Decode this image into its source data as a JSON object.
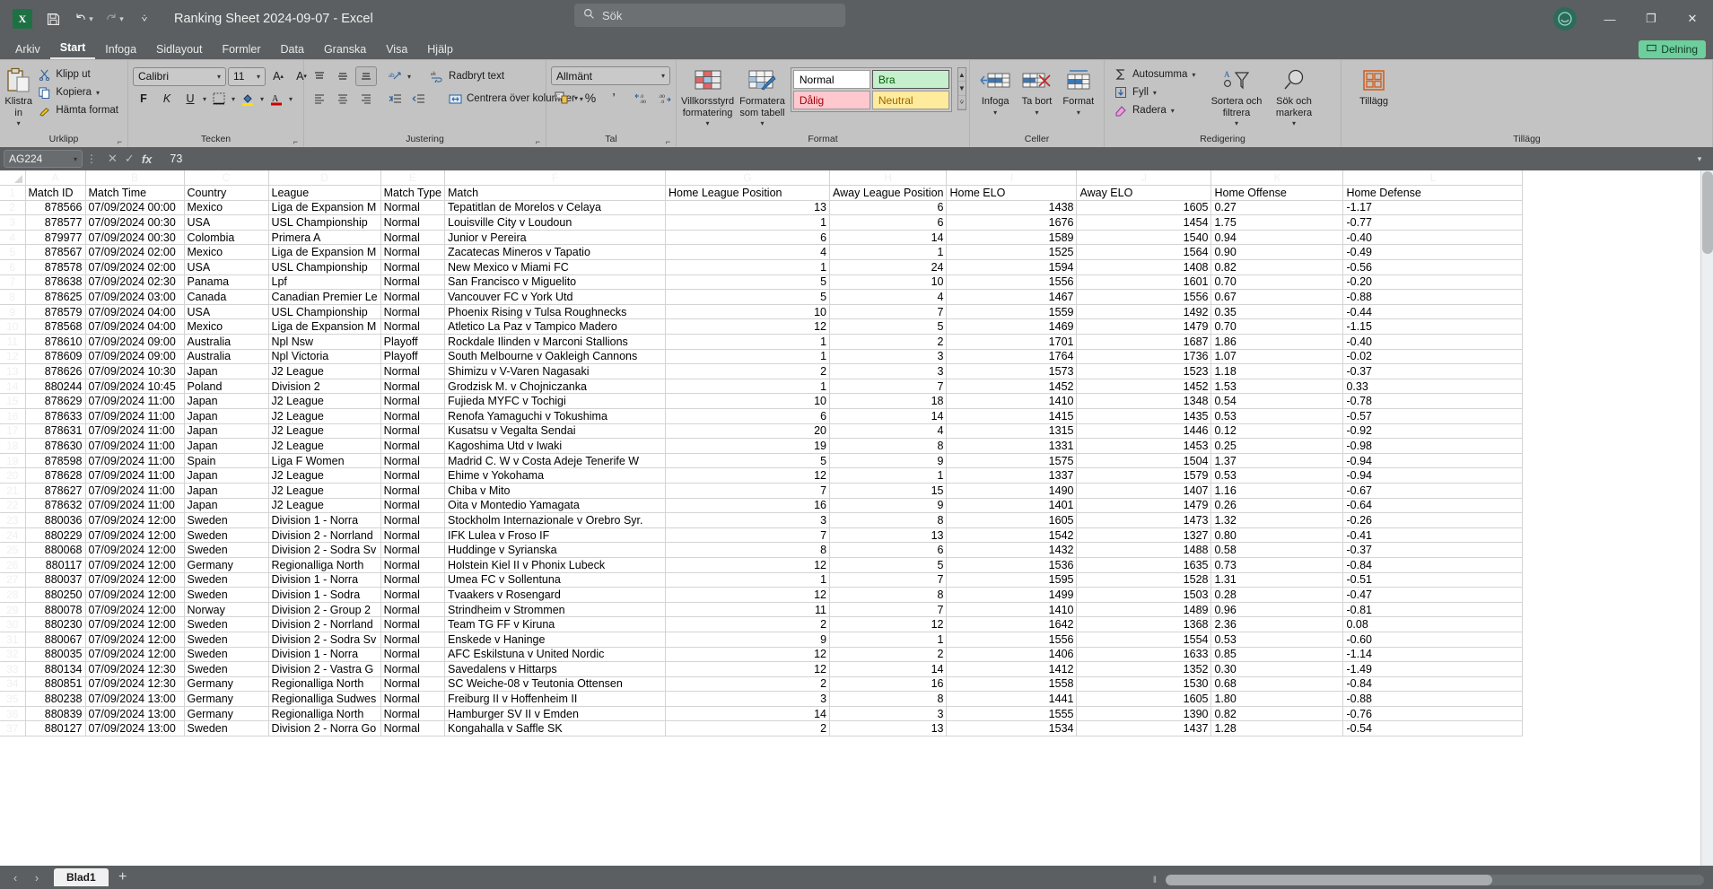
{
  "titlebar": {
    "app_icon": "excel-logo",
    "save_icon": "save-icon",
    "undo_icon": "undo-icon",
    "redo_icon": "redo-icon",
    "customize_icon": "customize-quick-access-icon",
    "document_title": "Ranking Sheet 2024-09-07  -  Excel",
    "search_placeholder": "Sök",
    "search_icon": "search-icon",
    "account_icon": "account-avatar",
    "minimize": "—",
    "maximize": "❐",
    "close": "✕"
  },
  "tabs": [
    {
      "label": "Arkiv",
      "active": false
    },
    {
      "label": "Start",
      "active": true
    },
    {
      "label": "Infoga",
      "active": false
    },
    {
      "label": "Sidlayout",
      "active": false
    },
    {
      "label": "Formler",
      "active": false
    },
    {
      "label": "Data",
      "active": false
    },
    {
      "label": "Granska",
      "active": false
    },
    {
      "label": "Visa",
      "active": false
    },
    {
      "label": "Hjälp",
      "active": false
    }
  ],
  "share_button": {
    "label": "Delning",
    "icon": "share-icon",
    "color": "#6dcf9c"
  },
  "ribbon": {
    "clipboard": {
      "group_label": "Urklipp",
      "paste": "Klistra in",
      "cut": "Klipp ut",
      "copy": "Kopiera",
      "format_painter": "Hämta format"
    },
    "font": {
      "group_label": "Tecken",
      "font_name": "Calibri",
      "font_size": "11",
      "grow": "A",
      "shrink": "A",
      "bold": "F",
      "italic": "K",
      "underline": "U"
    },
    "alignment": {
      "group_label": "Justering",
      "wrap_text": "Radbryt text",
      "merge_center": "Centrera över kolumner"
    },
    "number": {
      "group_label": "Tal",
      "format": "Allmänt",
      "percent": "%",
      "comma": "’"
    },
    "styles": {
      "group_label": "Format",
      "conditional": "Villkorsstyrd formatering",
      "as_table": "Formatera som tabell",
      "cells": [
        {
          "label": "Normal",
          "bg": "#ffffff",
          "fg": "#000000"
        },
        {
          "label": "Bra",
          "bg": "#c6efce",
          "fg": "#006100"
        },
        {
          "label": "Dålig",
          "bg": "#ffc7ce",
          "fg": "#9c0006"
        },
        {
          "label": "Neutral",
          "bg": "#ffeb9c",
          "fg": "#9c6500"
        }
      ]
    },
    "cells_group": {
      "group_label": "Celler",
      "insert": "Infoga",
      "delete": "Ta bort",
      "format": "Format"
    },
    "editing": {
      "group_label": "Redigering",
      "autosum": "Autosumma",
      "fill": "Fyll",
      "clear": "Radera",
      "sort_filter": "Sortera och filtrera",
      "find_select": "Sök och markera"
    },
    "addins": {
      "group_label": "Tillägg",
      "addins": "Tillägg"
    }
  },
  "formula_bar": {
    "name_box": "AG224",
    "cancel_icon": "cancel-icon",
    "confirm_icon": "confirm-icon",
    "fx_icon": "fx",
    "value": "73",
    "expand_icon": "expand-formula-bar-icon"
  },
  "sheet": {
    "columns": [
      "A",
      "B",
      "C",
      "D",
      "E",
      "F",
      "G",
      "H",
      "I",
      "J",
      "K",
      "L"
    ],
    "headers": [
      "Match ID",
      "Match Time",
      "Country",
      "League",
      "Match Type",
      "Match",
      "Home League Position",
      "Away League Position",
      "Home ELO",
      "Away ELO",
      "Home Offense",
      "Home Defense"
    ],
    "rows": [
      [
        "878566",
        "07/09/2024 00:00",
        "Mexico",
        "Liga de Expansion M",
        "Normal",
        "Tepatitlan de Morelos v Celaya",
        "13",
        "6",
        "1438",
        "1605",
        "0.27",
        "-1.17"
      ],
      [
        "878577",
        "07/09/2024 00:30",
        "USA",
        "USL Championship",
        "Normal",
        "Louisville City v Loudoun",
        "1",
        "6",
        "1676",
        "1454",
        "1.75",
        "-0.77"
      ],
      [
        "879977",
        "07/09/2024 00:30",
        "Colombia",
        "Primera A",
        "Normal",
        "Junior v Pereira",
        "6",
        "14",
        "1589",
        "1540",
        "0.94",
        "-0.40"
      ],
      [
        "878567",
        "07/09/2024 02:00",
        "Mexico",
        "Liga de Expansion M",
        "Normal",
        "Zacatecas Mineros v Tapatio",
        "4",
        "1",
        "1525",
        "1564",
        "0.90",
        "-0.49"
      ],
      [
        "878578",
        "07/09/2024 02:00",
        "USA",
        "USL Championship",
        "Normal",
        "New Mexico v Miami FC",
        "1",
        "24",
        "1594",
        "1408",
        "0.82",
        "-0.56"
      ],
      [
        "878638",
        "07/09/2024 02:30",
        "Panama",
        "Lpf",
        "Normal",
        "San Francisco v Miguelito",
        "5",
        "10",
        "1556",
        "1601",
        "0.70",
        "-0.20"
      ],
      [
        "878625",
        "07/09/2024 03:00",
        "Canada",
        "Canadian Premier Le",
        "Normal",
        "Vancouver FC v York Utd",
        "5",
        "4",
        "1467",
        "1556",
        "0.67",
        "-0.88"
      ],
      [
        "878579",
        "07/09/2024 04:00",
        "USA",
        "USL Championship",
        "Normal",
        "Phoenix Rising v Tulsa Roughnecks",
        "10",
        "7",
        "1559",
        "1492",
        "0.35",
        "-0.44"
      ],
      [
        "878568",
        "07/09/2024 04:00",
        "Mexico",
        "Liga de Expansion M",
        "Normal",
        "Atletico La Paz v Tampico Madero",
        "12",
        "5",
        "1469",
        "1479",
        "0.70",
        "-1.15"
      ],
      [
        "878610",
        "07/09/2024 09:00",
        "Australia",
        "Npl Nsw",
        "Playoff",
        "Rockdale Ilinden v Marconi Stallions",
        "1",
        "2",
        "1701",
        "1687",
        "1.86",
        "-0.40"
      ],
      [
        "878609",
        "07/09/2024 09:00",
        "Australia",
        "Npl Victoria",
        "Playoff",
        "South Melbourne v Oakleigh Cannons",
        "1",
        "3",
        "1764",
        "1736",
        "1.07",
        "-0.02"
      ],
      [
        "878626",
        "07/09/2024 10:30",
        "Japan",
        "J2 League",
        "Normal",
        "Shimizu v V-Varen Nagasaki",
        "2",
        "3",
        "1573",
        "1523",
        "1.18",
        "-0.37"
      ],
      [
        "880244",
        "07/09/2024 10:45",
        "Poland",
        "Division 2",
        "Normal",
        "Grodzisk M. v Chojniczanka",
        "1",
        "7",
        "1452",
        "1452",
        "1.53",
        "0.33"
      ],
      [
        "878629",
        "07/09/2024 11:00",
        "Japan",
        "J2 League",
        "Normal",
        "Fujieda MYFC v Tochigi",
        "10",
        "18",
        "1410",
        "1348",
        "0.54",
        "-0.78"
      ],
      [
        "878633",
        "07/09/2024 11:00",
        "Japan",
        "J2 League",
        "Normal",
        "Renofa Yamaguchi v Tokushima",
        "6",
        "14",
        "1415",
        "1435",
        "0.53",
        "-0.57"
      ],
      [
        "878631",
        "07/09/2024 11:00",
        "Japan",
        "J2 League",
        "Normal",
        "Kusatsu v Vegalta Sendai",
        "20",
        "4",
        "1315",
        "1446",
        "0.12",
        "-0.92"
      ],
      [
        "878630",
        "07/09/2024 11:00",
        "Japan",
        "J2 League",
        "Normal",
        "Kagoshima Utd v Iwaki",
        "19",
        "8",
        "1331",
        "1453",
        "0.25",
        "-0.98"
      ],
      [
        "878598",
        "07/09/2024 11:00",
        "Spain",
        "Liga F Women",
        "Normal",
        "Madrid C. W v Costa Adeje Tenerife W",
        "5",
        "9",
        "1575",
        "1504",
        "1.37",
        "-0.94"
      ],
      [
        "878628",
        "07/09/2024 11:00",
        "Japan",
        "J2 League",
        "Normal",
        "Ehime v Yokohama",
        "12",
        "1",
        "1337",
        "1579",
        "0.53",
        "-0.94"
      ],
      [
        "878627",
        "07/09/2024 11:00",
        "Japan",
        "J2 League",
        "Normal",
        "Chiba v Mito",
        "7",
        "15",
        "1490",
        "1407",
        "1.16",
        "-0.67"
      ],
      [
        "878632",
        "07/09/2024 11:00",
        "Japan",
        "J2 League",
        "Normal",
        "Oita v Montedio Yamagata",
        "16",
        "9",
        "1401",
        "1479",
        "0.26",
        "-0.64"
      ],
      [
        "880036",
        "07/09/2024 12:00",
        "Sweden",
        "Division 1 - Norra",
        "Normal",
        "Stockholm Internazionale v Orebro Syr.",
        "3",
        "8",
        "1605",
        "1473",
        "1.32",
        "-0.26"
      ],
      [
        "880229",
        "07/09/2024 12:00",
        "Sweden",
        "Division 2 - Norrland",
        "Normal",
        "IFK Lulea v Froso IF",
        "7",
        "13",
        "1542",
        "1327",
        "0.80",
        "-0.41"
      ],
      [
        "880068",
        "07/09/2024 12:00",
        "Sweden",
        "Division 2 - Sodra Sv",
        "Normal",
        "Huddinge v Syrianska",
        "8",
        "6",
        "1432",
        "1488",
        "0.58",
        "-0.37"
      ],
      [
        "880117",
        "07/09/2024 12:00",
        "Germany",
        "Regionalliga North",
        "Normal",
        "Holstein Kiel II v Phonix Lubeck",
        "12",
        "5",
        "1536",
        "1635",
        "0.73",
        "-0.84"
      ],
      [
        "880037",
        "07/09/2024 12:00",
        "Sweden",
        "Division 1 - Norra",
        "Normal",
        "Umea FC v Sollentuna",
        "1",
        "7",
        "1595",
        "1528",
        "1.31",
        "-0.51"
      ],
      [
        "880250",
        "07/09/2024 12:00",
        "Sweden",
        "Division 1 - Sodra",
        "Normal",
        "Tvaakers v Rosengard",
        "12",
        "8",
        "1499",
        "1503",
        "0.28",
        "-0.47"
      ],
      [
        "880078",
        "07/09/2024 12:00",
        "Norway",
        "Division 2 - Group 2",
        "Normal",
        "Strindheim v Strommen",
        "11",
        "7",
        "1410",
        "1489",
        "0.96",
        "-0.81"
      ],
      [
        "880230",
        "07/09/2024 12:00",
        "Sweden",
        "Division 2 - Norrland",
        "Normal",
        "Team TG FF v Kiruna",
        "2",
        "12",
        "1642",
        "1368",
        "2.36",
        "0.08"
      ],
      [
        "880067",
        "07/09/2024 12:00",
        "Sweden",
        "Division 2 - Sodra Sv",
        "Normal",
        "Enskede v Haninge",
        "9",
        "1",
        "1556",
        "1554",
        "0.53",
        "-0.60"
      ],
      [
        "880035",
        "07/09/2024 12:00",
        "Sweden",
        "Division 1 - Norra",
        "Normal",
        "AFC Eskilstuna v United Nordic",
        "12",
        "2",
        "1406",
        "1633",
        "0.85",
        "-1.14"
      ],
      [
        "880134",
        "07/09/2024 12:30",
        "Sweden",
        "Division 2 - Vastra G",
        "Normal",
        "Savedalens v Hittarps",
        "12",
        "14",
        "1412",
        "1352",
        "0.30",
        "-1.49"
      ],
      [
        "880851",
        "07/09/2024 12:30",
        "Germany",
        "Regionalliga North",
        "Normal",
        "SC Weiche-08 v Teutonia Ottensen",
        "2",
        "16",
        "1558",
        "1530",
        "0.68",
        "-0.84"
      ],
      [
        "880238",
        "07/09/2024 13:00",
        "Germany",
        "Regionalliga Sudwes",
        "Normal",
        "Freiburg II v Hoffenheim II",
        "3",
        "8",
        "1441",
        "1605",
        "1.80",
        "-0.88"
      ],
      [
        "880839",
        "07/09/2024 13:00",
        "Germany",
        "Regionalliga North",
        "Normal",
        "Hamburger SV II v Emden",
        "14",
        "3",
        "1555",
        "1390",
        "0.82",
        "-0.76"
      ],
      [
        "880127",
        "07/09/2024 13:00",
        "Sweden",
        "Division 2 - Norra Go",
        "Normal",
        "Kongahalla v Saffle SK",
        "2",
        "13",
        "1534",
        "1437",
        "1.28",
        "-0.54"
      ]
    ]
  },
  "sheetbar": {
    "prev_icon": "‹",
    "next_icon": "›",
    "tab_name": "Blad1",
    "add_sheet": "+"
  }
}
